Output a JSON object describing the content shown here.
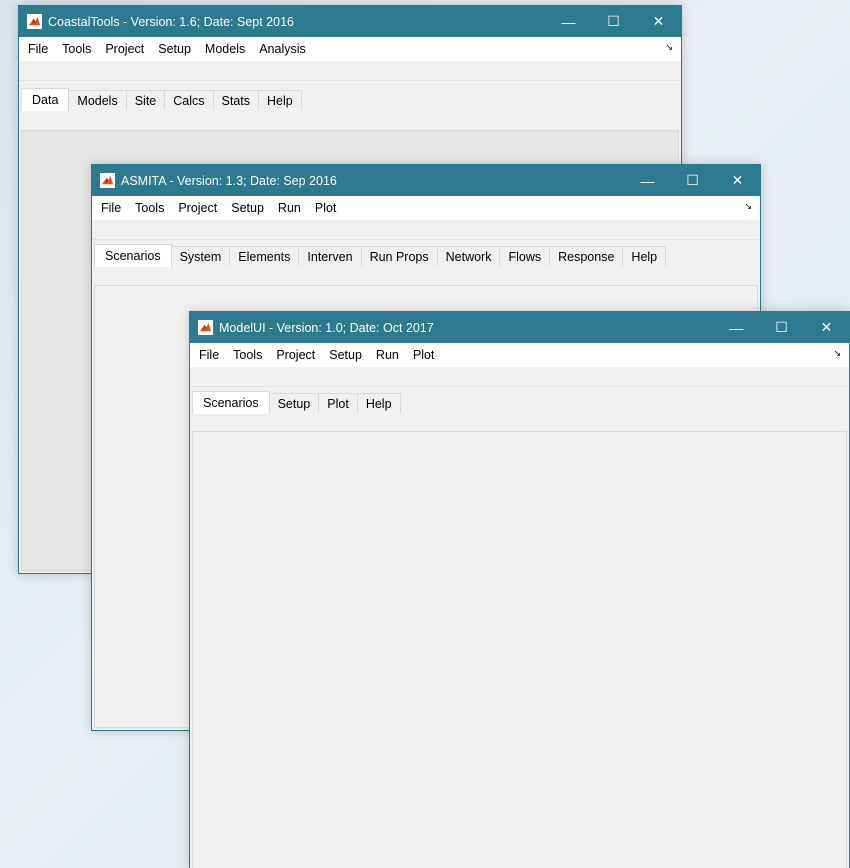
{
  "windows": {
    "coastal": {
      "title": "CoastalTools - Version: 1.6;  Date: Sept 2016",
      "menu": [
        "File",
        "Tools",
        "Project",
        "Setup",
        "Models",
        "Analysis"
      ],
      "tabs": [
        "Data",
        "Models",
        "Site",
        "Calcs",
        "Stats",
        "Help"
      ],
      "active_tab": "Data"
    },
    "asmita": {
      "title": "ASMITA - Version: 1.3;  Date: Sep 2016",
      "menu": [
        "File",
        "Tools",
        "Project",
        "Setup",
        "Run",
        "Plot"
      ],
      "tabs": [
        "Scenarios",
        "System",
        "Elements",
        "Interven",
        "Run Props",
        "Network",
        "Flows",
        "Response",
        "Help"
      ],
      "active_tab": "Scenarios"
    },
    "modelui": {
      "title": "ModelUI - Version: 1.0;  Date: Oct 2017",
      "menu": [
        "File",
        "Tools",
        "Project",
        "Setup",
        "Run",
        "Plot"
      ],
      "tabs": [
        "Scenarios",
        "Setup",
        "Plot",
        "Help"
      ],
      "active_tab": "Scenarios"
    }
  },
  "window_controls": {
    "minimize": "—",
    "maximize": "☐",
    "close": "✕"
  },
  "icons": {
    "app": "matlab-icon",
    "menu_expand": "dock-arrow-icon"
  },
  "colors": {
    "titlebar": "#2b7a8e",
    "background": "#f0f0f0"
  }
}
